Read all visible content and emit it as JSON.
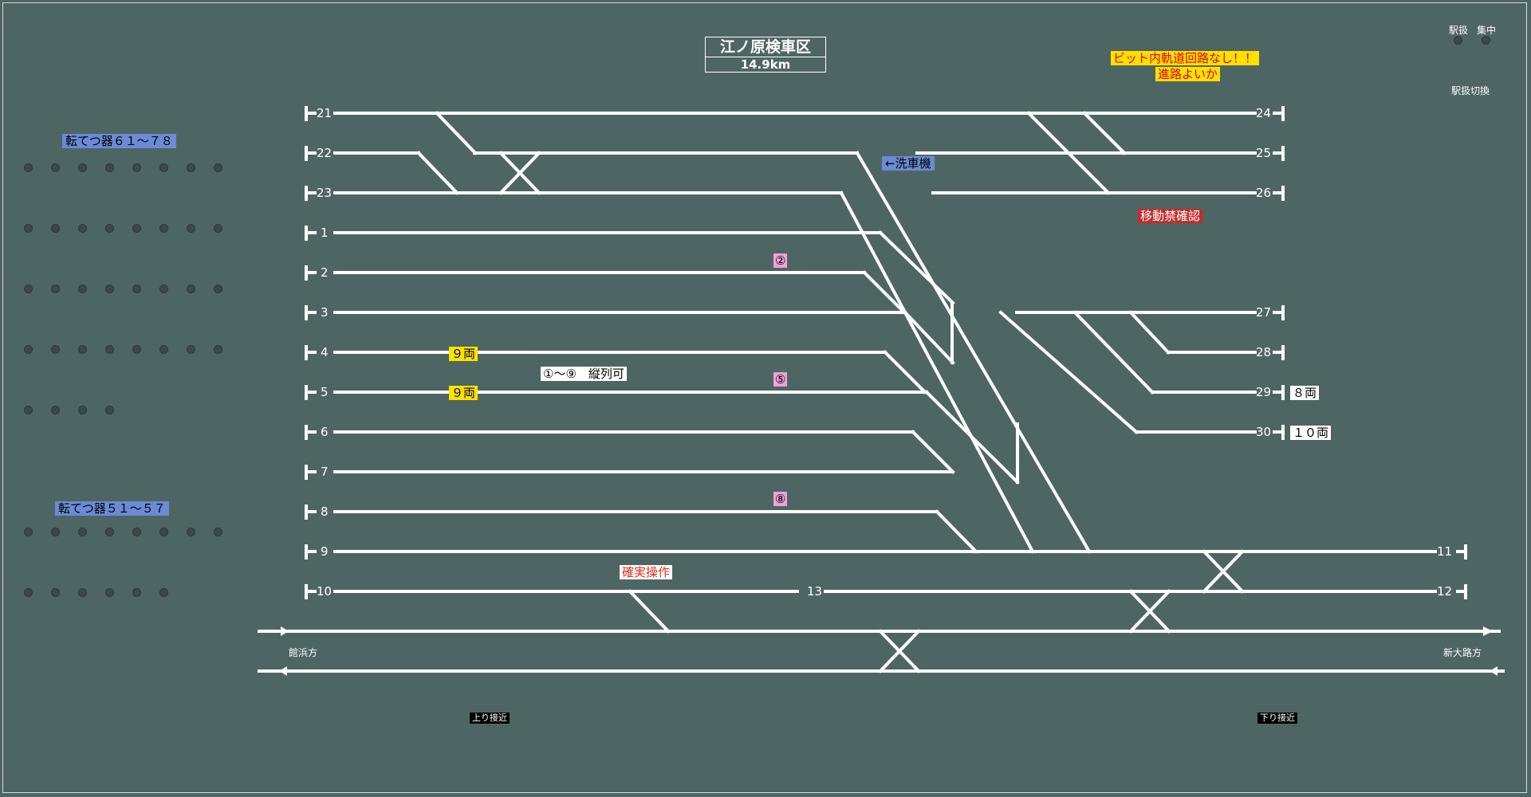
{
  "title": {
    "name": "江ノ原検車区",
    "distance": "14.9km"
  },
  "header_right": {
    "ekiatsukai": "駅扱",
    "shuchu": "集中",
    "switch_label": "駅扱切換"
  },
  "warning": {
    "line1": "ビット内軌道回路なし！！",
    "line2": "進路よいか"
  },
  "point_groups": {
    "group1": "転てつ器６１～７８",
    "group2": "転てつ器５１～５７"
  },
  "labels": {
    "washer": "←洗車機",
    "move_ban": "移動禁確認",
    "tandem": "①～⑨　縦列可",
    "sure_op": "確実操作",
    "track4_cars": "９両",
    "track5_cars": "９両",
    "track29_cars": "８両",
    "track30_cars": "１０両",
    "marker2": "②",
    "marker5": "⑤",
    "marker8": "⑧",
    "dir_left": "館浜方",
    "dir_right": "新大路方",
    "approach_up": "上り接近",
    "approach_down": "下り接近"
  },
  "tracks": {
    "t21": "21",
    "t22": "22",
    "t23": "23",
    "t1": "1",
    "t2": "2",
    "t3": "3",
    "t4": "4",
    "t5": "5",
    "t6": "6",
    "t7": "7",
    "t8": "8",
    "t9": "9",
    "t10": "10",
    "t13": "13",
    "t11": "11",
    "t12": "12",
    "t24": "24",
    "t25": "25",
    "t26": "26",
    "t27": "27",
    "t28": "28",
    "t29": "29",
    "t30": "30"
  },
  "colors": {
    "background": "#4e6663",
    "track": "#ffffff",
    "blue_label": "#6b8bd6",
    "yellow_label": "#ffe100",
    "pink_label": "#f0a0d8",
    "red_label": "#c52b2b"
  }
}
